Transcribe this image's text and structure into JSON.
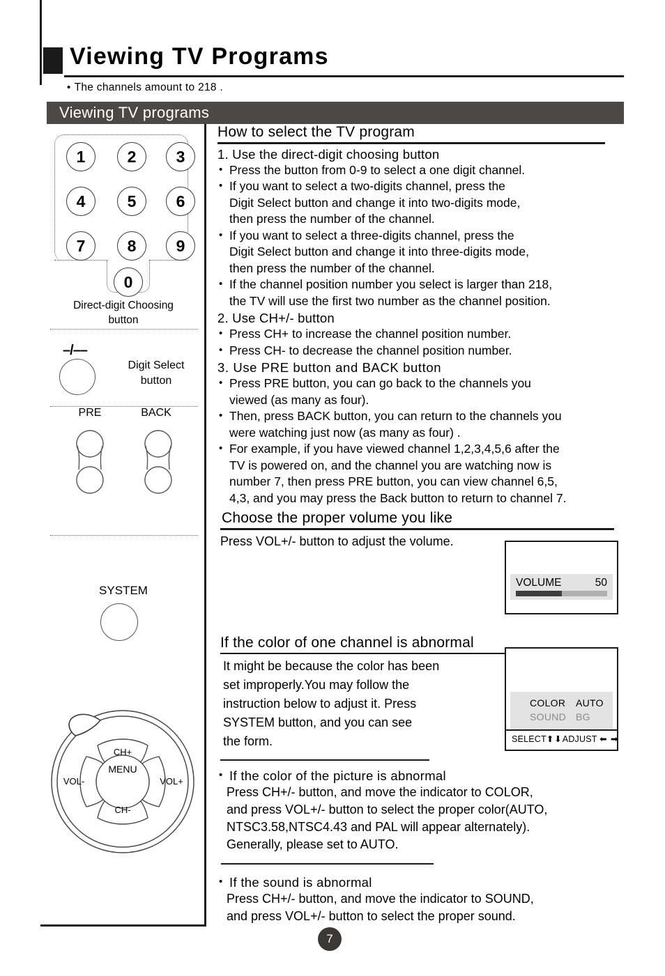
{
  "header": {
    "title": "Viewing TV Programs",
    "note": "The channels amount to 218 .",
    "section_bar": "Viewing TV programs",
    "bullet_glyph": "•"
  },
  "remote": {
    "keypad": {
      "keys": [
        "1",
        "2",
        "3",
        "4",
        "5",
        "6",
        "7",
        "8",
        "9",
        "0"
      ],
      "caption_line1": "Direct-digit Choosing",
      "caption_line2": "button"
    },
    "digit_select": {
      "symbol": "–/––",
      "caption_line1": "Digit Select",
      "caption_line2": "button"
    },
    "pre_label": "PRE",
    "back_label": "BACK",
    "system_label": "SYSTEM",
    "wheel": {
      "up": "CH+",
      "down": "CH-",
      "left": "VOL-",
      "right": "VOL+",
      "center": "MENU"
    }
  },
  "sections": {
    "select_program": {
      "heading": "How to select the TV program",
      "step1": "1. Use the direct-digit choosing button",
      "step1_bullets": [
        "Press the button from 0-9 to select a one digit channel.",
        "If you want to select a two-digits channel,  press the\n   Digit Select button and change it into two-digits mode,\n   then press the number of the channel.",
        "If you want to select a three-digits channel,  press the\n   Digit Select button and change it into three-digits mode,\n   then press the number of the channel.",
        "If the channel position number you select is larger than 218,\n   the TV will use the first two number as the channel position."
      ],
      "step2": "2. Use CH+/- button",
      "step2_bullets": [
        "Press CH+ to increase the channel position number.",
        "Press CH- to decrease the channel position number."
      ],
      "step3": "3. Use PRE button and BACK button",
      "step3_bullets": [
        "Press PRE button, you can go back to the channels you\n   viewed (as many as four).",
        "Then, press BACK button, you can return to the channels you\n   were watching just now (as many as four) .",
        "For example, if you have viewed channel 1,2,3,4,5,6 after the\n   TV is powered on, and the channel you are watching now is\n   number 7, then press PRE button, you can view channel 6,5,\n   4,3, and you may press the Back button to return to channel 7."
      ]
    },
    "volume": {
      "heading": "Choose the proper volume you like",
      "body": "Press VOL+/- button to adjust the volume.",
      "osd": {
        "name": "VOLUME",
        "value": "50",
        "fill_percent": 50
      }
    },
    "color": {
      "heading": "If the color of one channel is abnormal",
      "body": "It might be because the color  has been\nset improperly.You may follow the\ninstruction below to adjust it. Press\nSYSTEM button, and you can see\nthe form.",
      "osd": {
        "rows": [
          {
            "key": "COLOR",
            "value": "AUTO",
            "state": "active"
          },
          {
            "key": "SOUND",
            "value": "BG",
            "state": "dim"
          }
        ],
        "footer_select": "SELECT",
        "footer_updown": "⬆⬇",
        "footer_adjust": "ADJUST",
        "footer_leftright": "⬅ ➡"
      },
      "picture_bullet_title": "If the color of the picture is abnormal",
      "picture_bullet_body": "Press CH+/- button, and move the indicator to  COLOR,\n and press VOL+/- button to select the proper color(AUTO,\n NTSC3.58,NTSC4.43 and PAL  will appear alternately).\n Generally, please set to AUTO.",
      "sound_bullet_title": "If the sound is abnormal",
      "sound_bullet_body": "Press CH+/- button, and move the indicator to  SOUND,\n and press VOL+/- button to select the proper sound."
    }
  },
  "footer": {
    "page_number": "7"
  },
  "colors": {
    "section_bar_bg": "#4c4845",
    "osd_band": "#e3e3e3",
    "bar_fill": "#3d3d3d",
    "page_badge": "#3b3836"
  }
}
